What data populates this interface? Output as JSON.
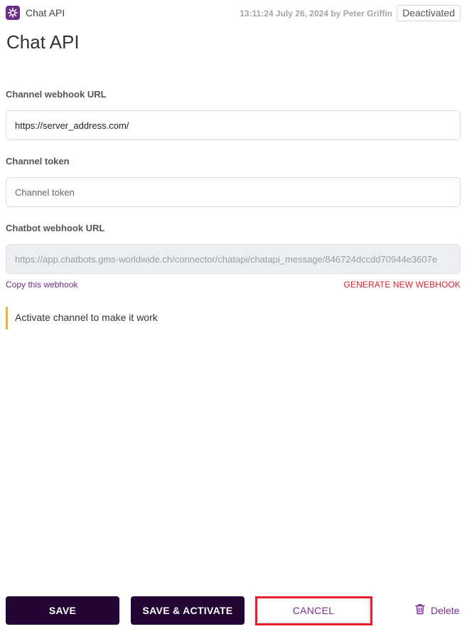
{
  "header": {
    "app_name": "Chat API",
    "meta": "13:11:24 July 26, 2024 by Peter Griffin",
    "status": "Deactivated",
    "icon": "chat-api-icon"
  },
  "page_title": "Chat API",
  "form": {
    "channel_webhook": {
      "label": "Channel webhook URL",
      "value": "https://server_address.com/"
    },
    "channel_token": {
      "label": "Channel token",
      "placeholder": "Channel token"
    },
    "chatbot_webhook": {
      "label": "Chatbot webhook URL",
      "value": "https://app.chatbots.gms-worldwide.ch/connector/chatapi/chatapi_message/846724dccdd70944e3607e"
    },
    "copy_link": "Copy this webhook",
    "generate_link": "GENERATE NEW WEBHOOK"
  },
  "notice": {
    "text": "Activate channel to make it work"
  },
  "footer": {
    "save": "SAVE",
    "save_activate": "SAVE & ACTIVATE",
    "cancel": "CANCEL",
    "delete": "Delete"
  },
  "colors": {
    "brand_purple": "#6c2d86",
    "dark_button": "#230633",
    "danger_red": "#e0202a",
    "notice_accent": "#f0b13a"
  }
}
